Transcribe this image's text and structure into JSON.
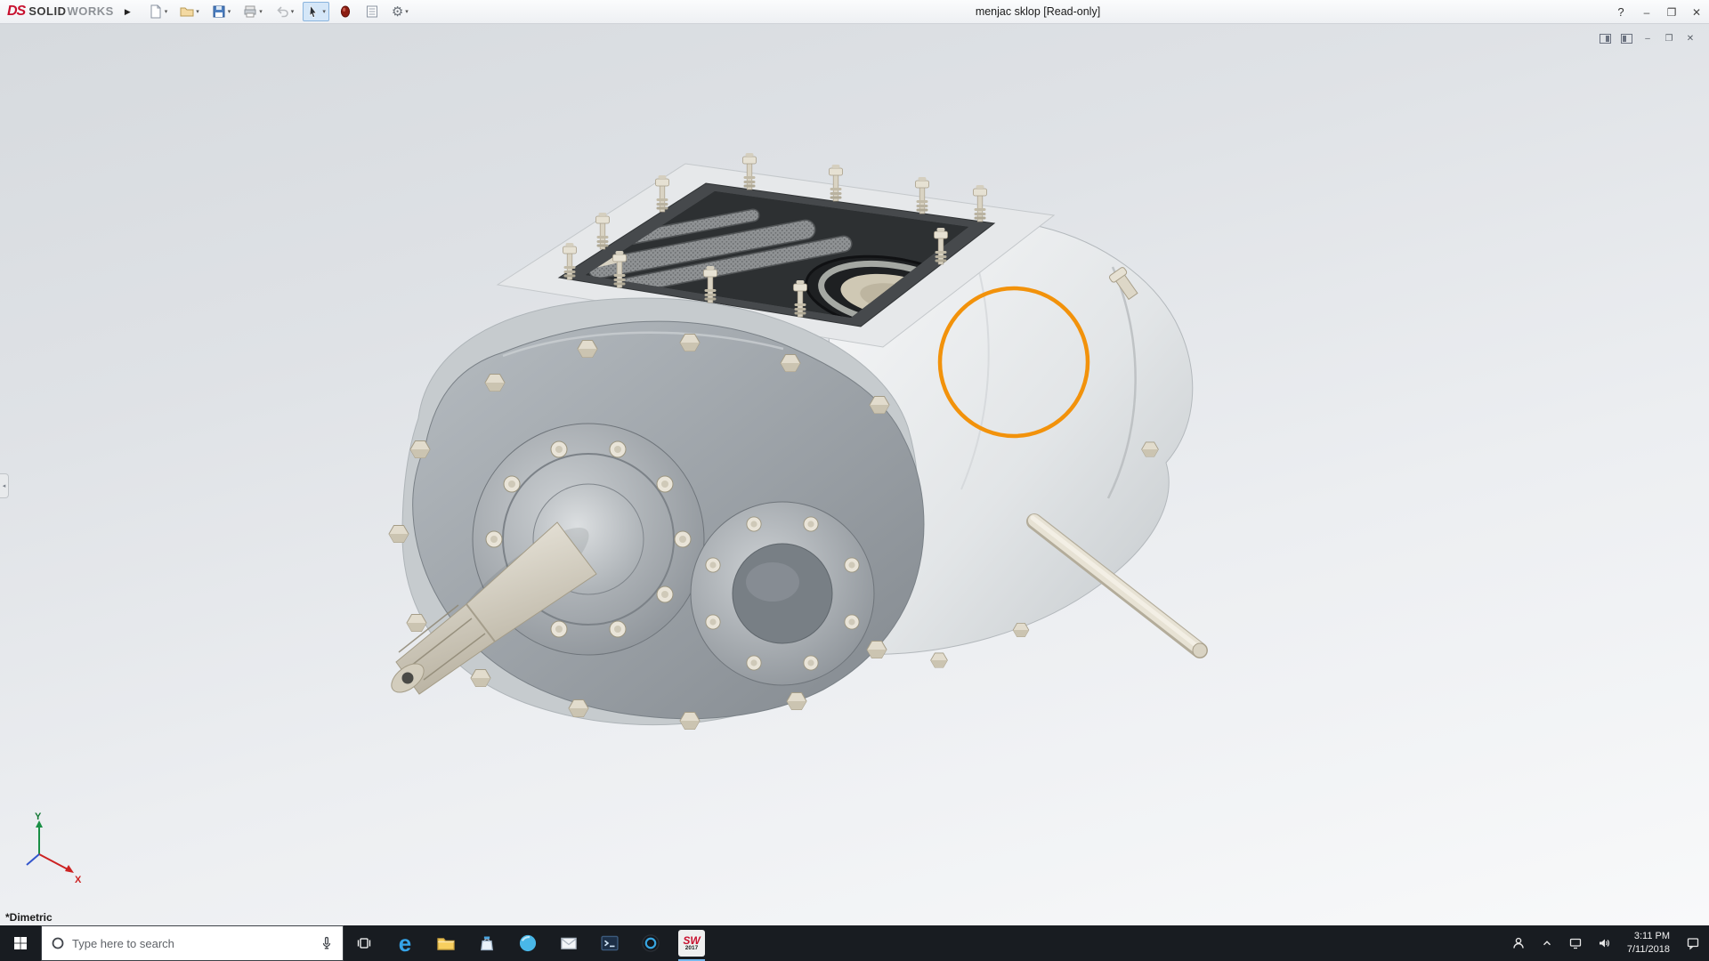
{
  "ui": {
    "dropdown_glyph": "▾",
    "flyout_glyph": "◂"
  },
  "colors": {
    "brand_red": "#c8102e",
    "annotation_orange": "#F2920B",
    "select_highlight": "#d5e7f8"
  },
  "titlebar": {
    "logo": {
      "monogram": "DS",
      "solid": "SOLID",
      "works": "WORKS"
    },
    "menu_expand_glyph": "▶",
    "title": "menjac sklop [Read-only]",
    "help_glyph": "?",
    "gear_glyph": "⚙",
    "window_controls": {
      "minimize": "–",
      "maximize": "❐",
      "close": "✕"
    }
  },
  "document_window_controls": {
    "minimize": "–",
    "restore": "❐",
    "close": "✕"
  },
  "viewport": {
    "view_orientation": "*Dimetric",
    "triad": {
      "x_label": "X",
      "y_label": "Y"
    }
  },
  "taskbar": {
    "search": {
      "placeholder": "Type here to search"
    },
    "clock": {
      "time": "3:11 PM",
      "date": "7/11/2018"
    },
    "icons": {
      "edge_letter": "e",
      "solidworks": {
        "line1": "SW",
        "line2": "2017"
      }
    }
  }
}
